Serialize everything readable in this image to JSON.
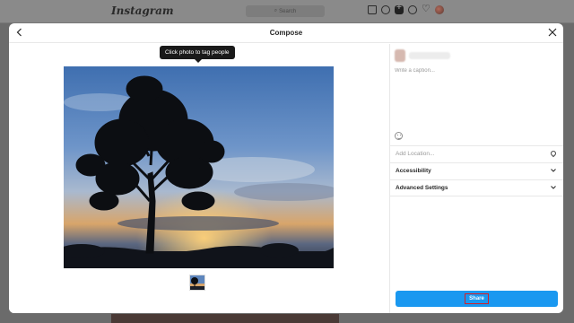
{
  "app": {
    "logo": "Instagram",
    "search_placeholder": "Search",
    "nav_icons": [
      "home-icon",
      "messenger-icon",
      "new-post-icon",
      "explore-icon",
      "heart-icon",
      "profile-avatar"
    ]
  },
  "modal": {
    "title": "Compose",
    "back_icon": "arrow-left-icon",
    "close_icon": "close-icon",
    "tooltip": "Click photo to tag people",
    "caption_placeholder": "Write a caption...",
    "location_placeholder": "Add Location...",
    "accessibility_label": "Accessibility",
    "advanced_label": "Advanced Settings",
    "share_label": "Share"
  },
  "colors": {
    "share_button": "#1a98f0",
    "highlight": "#d61f26",
    "overlay": "#6b6b6b"
  }
}
